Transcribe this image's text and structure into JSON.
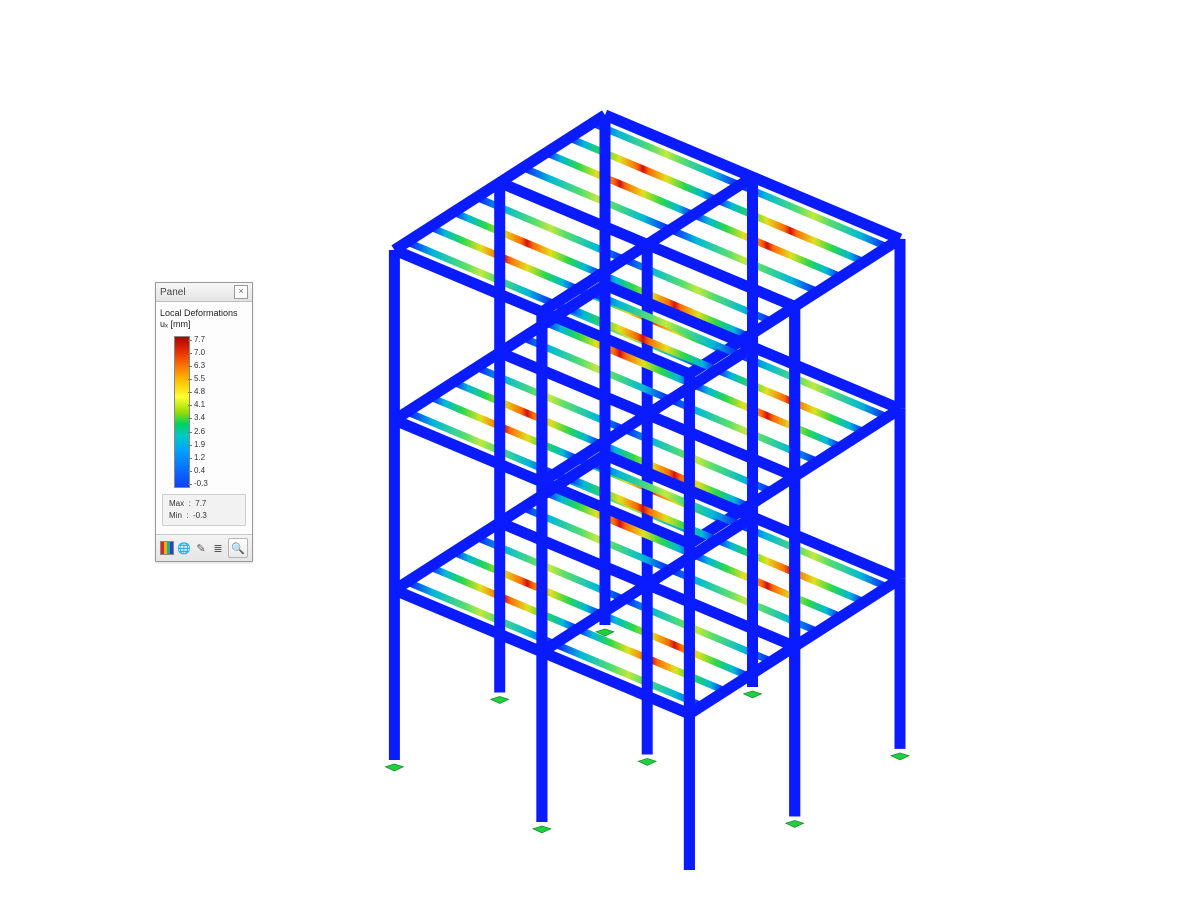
{
  "panel": {
    "title": "Panel",
    "close": "×",
    "result_label": "Local Deformations",
    "component": "uₓ [mm]",
    "scale_ticks": [
      "7.7",
      "7.0",
      "6.3",
      "5.5",
      "4.8",
      "4.1",
      "3.4",
      "2.6",
      "1.9",
      "1.2",
      "0.4",
      "-0.3"
    ],
    "max_label": "Max",
    "max_value": "7.7",
    "min_label": "Min",
    "min_value": "-0.3",
    "toolbar": {
      "stripes": "color-scale-icon",
      "globe": "🌐",
      "pencil": "✎",
      "lines": "≣",
      "zoom": "🔍"
    }
  },
  "colors": {
    "member_blue": "#0a1bff",
    "support": "#20d040",
    "gradient_hot": "#d11010",
    "gradient_cold": "#00b0ff"
  }
}
